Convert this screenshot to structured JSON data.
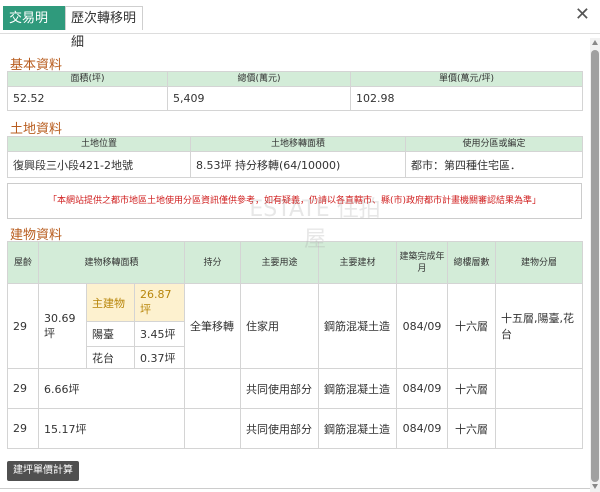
{
  "tabs": [
    "交易明細",
    "歷次轉移明細"
  ],
  "basic": {
    "title": "基本資料",
    "headers": [
      "面積(坪)",
      "總價(萬元)",
      "單價(萬元/坪)"
    ],
    "values": [
      "52.52",
      "5,409",
      "102.98"
    ]
  },
  "land": {
    "title": "土地資料",
    "headers": [
      "土地位置",
      "土地移轉面積",
      "使用分區或編定"
    ],
    "values": [
      "復興段三小段421-2地號",
      "8.53坪 持分移轉(64/10000)",
      "都市：第四種住宅區．"
    ]
  },
  "notice": "「本網站提供之都市地區土地使用分區資訊僅供參考，如有疑義，仍請以各直轄市、縣(市)政府都市計畫機關審認結果為準」",
  "building": {
    "title": "建物資料",
    "headers": {
      "age": "屋齡",
      "area": "建物移轉面積",
      "share": "持分",
      "use": "主要用途",
      "material": "主要建材",
      "completed": "建築完成年月",
      "floors": "總樓層數",
      "floor": "建物分層"
    },
    "rows": [
      {
        "age": "29",
        "area": "30.69坪",
        "parts": [
          {
            "name": "主建物",
            "value": "26.87坪"
          },
          {
            "name": "陽臺",
            "value": "3.45坪"
          },
          {
            "name": "花台",
            "value": "0.37坪"
          }
        ],
        "share": "全筆移轉",
        "use": "住家用",
        "material": "鋼筋混凝土造",
        "completed": "084/09",
        "floors": "十六層",
        "floor": "十五層,陽臺,花台"
      },
      {
        "age": "29",
        "area": "6.66坪",
        "share": "",
        "use": "共同使用部分",
        "material": "鋼筋混凝土造",
        "completed": "084/09",
        "floors": "十六層",
        "floor": ""
      },
      {
        "age": "29",
        "area": "15.17坪",
        "share": "",
        "use": "共同使用部分",
        "material": "鋼筋混凝土造",
        "completed": "084/09",
        "floors": "十六層",
        "floor": ""
      }
    ]
  },
  "calc_button": "建坪單價計算",
  "watermark": "ESTATE 住拍屋"
}
